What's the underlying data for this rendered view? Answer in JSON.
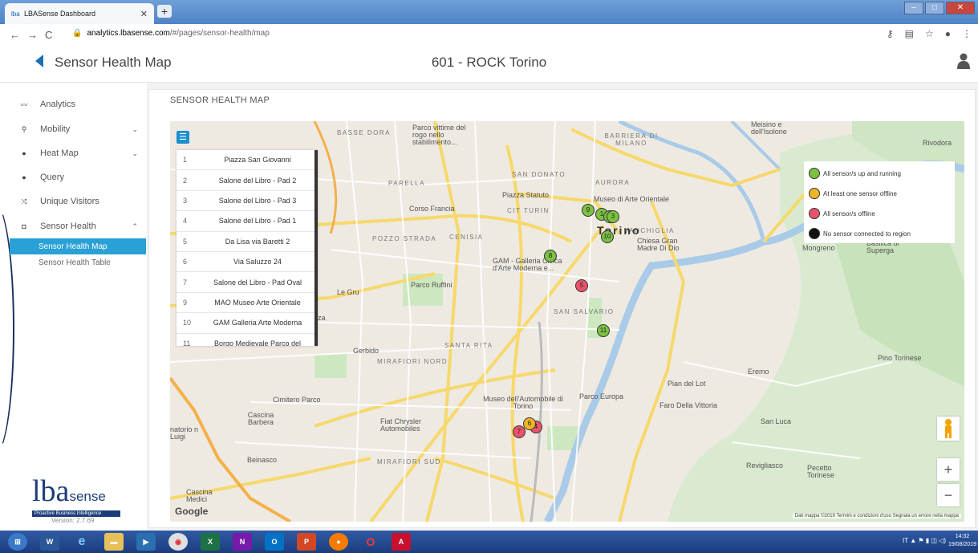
{
  "browser": {
    "tab_title": "LBASense Dashboard",
    "tab_favicon": "lba-icon",
    "url_host": "analytics.lbasense.com",
    "url_path": "/#/pages/sensor-health/map"
  },
  "header": {
    "page_title": "Sensor Health Map",
    "site_title": "601 - ROCK Torino"
  },
  "sidebar": {
    "items": [
      {
        "label": "Analytics",
        "icon": "chart-icon"
      },
      {
        "label": "Mobility",
        "icon": "bike-icon",
        "expandable": true
      },
      {
        "label": "Heat Map",
        "icon": "dot-icon",
        "expandable": true
      },
      {
        "label": "Query",
        "icon": "dot-icon"
      },
      {
        "label": "Unique Visitors",
        "icon": "shuffle-icon"
      },
      {
        "label": "Sensor Health",
        "icon": "camera-icon",
        "expanded": true
      }
    ],
    "subitems": [
      {
        "label": "Sensor Health Map",
        "active": true
      },
      {
        "label": "Sensor Health Table",
        "active": false
      }
    ],
    "logo_text": "lba",
    "logo_suffix": "sense",
    "logo_tagline": "Proactive Business Intelligence",
    "version": "Version: 2.7.69"
  },
  "card": {
    "title": "SENSOR HEALTH MAP"
  },
  "sensor_list": [
    {
      "n": "1",
      "name": "Piazza San Giovanni"
    },
    {
      "n": "2",
      "name": "Salone del Libro - Pad 2"
    },
    {
      "n": "3",
      "name": "Salone del Libro - Pad 3"
    },
    {
      "n": "4",
      "name": "Salone del Libro - Pad 1"
    },
    {
      "n": "5",
      "name": "Da Lisa via Baretti 2"
    },
    {
      "n": "6",
      "name": "Via Saluzzo 24"
    },
    {
      "n": "7",
      "name": "Salone del Libro - Pad Oval"
    },
    {
      "n": "9",
      "name": "MAO Museo Arte Orientale"
    },
    {
      "n": "10",
      "name": "GAM Galleria Arte Moderna"
    },
    {
      "n": "11",
      "name": "Borgo Medievale Parco del"
    }
  ],
  "legend": [
    {
      "label": "All sensor/s up and running",
      "color": "#7cc142"
    },
    {
      "label": "At least one sensor offline",
      "color": "#f0b429"
    },
    {
      "label": "All sensor/s offline",
      "color": "#e8536b"
    },
    {
      "label": "No sensor connected to region",
      "color": "#111111"
    }
  ],
  "map_labels": [
    "BASSE DORA",
    "Parco vittime del rogo nello stabilimento...",
    "BARRIERA DI MILANO",
    "AURORA",
    "SAN DONATO",
    "PARELLA",
    "Piazza Statuto",
    "Museo di Arte Orientale",
    "CIT TURIN",
    "Corso Francia",
    "CENISIA",
    "POZZO STRADA",
    "VANCHIGLIA",
    "Chiesa Gran Madre Di Dio",
    "GAM - Galleria Civica d'Arte Moderna e...",
    "Parco Ruffini",
    "Le Gru",
    "SAN SALVARIO",
    "SANTA RITA",
    "Gerbido",
    "MIRAFIORI NORD",
    "Cimitero Parco",
    "Cascina Barbera",
    "Museo dell'Automobile di Torino",
    "Parco Europa",
    "Fiat Chrysler Automobiles",
    "MIRAFIORI SUD",
    "Beinasco",
    "Faro Della Vittoria",
    "San Luca",
    "Pian del Lot",
    "Eremo",
    "Pino Torinese",
    "Mongreno",
    "Basilica di Superga",
    "Revigliasco",
    "Pecetto Torinese",
    "Rivodora",
    "Torino",
    "natorio n Luigi",
    "Cascina Medici",
    "tezza",
    "Meisino e dell'Isolone"
  ],
  "pins": [
    {
      "label": "9",
      "status": "up"
    },
    {
      "label": "1",
      "status": "up"
    },
    {
      "label": "2",
      "status": "up"
    },
    {
      "label": "3",
      "status": "up"
    },
    {
      "label": "10",
      "status": "up"
    },
    {
      "label": "5",
      "status": "offline"
    },
    {
      "label": "11",
      "status": "up"
    },
    {
      "label": "7",
      "status": "offline"
    },
    {
      "label": "4",
      "status": "offline"
    },
    {
      "label": "6",
      "status": "partial"
    },
    {
      "label": "8",
      "status": "up"
    }
  ],
  "map_footer": {
    "brand": "Google",
    "attribution": "Dati mappa ©2019   Termini e condizioni d'uso   Segnala un errore nella mappa"
  },
  "taskbar": {
    "lang": "IT",
    "time": "14:32",
    "date": "19/08/2019"
  }
}
